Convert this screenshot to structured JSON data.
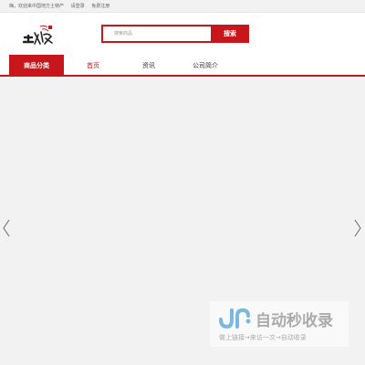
{
  "topbar": {
    "welcome": "嗨，欢迎来中国地方土特产",
    "login": "请登录",
    "register": "免费注册"
  },
  "header": {
    "logo_text": "土特产",
    "search_placeholder": "搜索商品",
    "search_button": "搜索"
  },
  "nav": {
    "category": "商品分类",
    "items": [
      {
        "label": "首页",
        "active": true
      },
      {
        "label": "资讯",
        "active": false
      },
      {
        "label": "公司简介",
        "active": false
      }
    ]
  },
  "banner": {
    "prev_icon": "chevron-left-icon",
    "next_icon": "chevron-right-icon"
  },
  "watermark": {
    "title": "自动秒收录",
    "subtitle": "做上链接→来访一次→自动收录"
  },
  "colors": {
    "accent": "#c8161d",
    "background": "#f2f2f2"
  }
}
